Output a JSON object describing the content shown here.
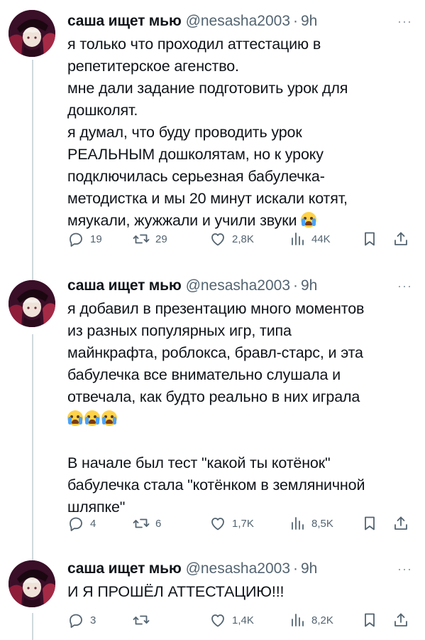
{
  "tweets": [
    {
      "name": "саша ищет мью",
      "handle": "@nesasha2003",
      "dot": "·",
      "time": "9h",
      "more": "···",
      "lines": [
        "я только что проходил аттестацию в",
        "репетитерское агенство.",
        "мне дали задание подготовить урок для",
        "дошколят.",
        "я думал, что буду проводить урок",
        "РЕАЛЬНЫМ дошколятам, но к уроку",
        "подключилась серьезная бабулечка-",
        "методистка и мы 20 минут искали котят,",
        "мяукали, жужжали и учили звуки"
      ],
      "emoji": "loudly-crying-face",
      "stats": {
        "replies": "19",
        "reposts": "29",
        "likes": "2,8K",
        "views": "44K"
      }
    },
    {
      "name": "саша ищет мью",
      "handle": "@nesasha2003",
      "dot": "·",
      "time": "9h",
      "more": "···",
      "lines": [
        "я добавил в презентацию много моментов",
        "из разных популярных игр, типа",
        "майнкрафта, роблокса, бравл-старс, и эта",
        "бабулечка все внимательно слушала и",
        "отвечала, как будто реально в них играла"
      ],
      "emoji_count": 3,
      "lines_2": [
        "В начале был тест \"какой ты котёнок\"",
        "бабулечка стала \"котёнком в земляничной",
        "шляпке\""
      ],
      "stats": {
        "replies": "4",
        "reposts": "6",
        "likes": "1,7K",
        "views": "8,5K"
      }
    },
    {
      "name": "саша ищет мью",
      "handle": "@nesasha2003",
      "dot": "·",
      "time": "9h",
      "more": "···",
      "lines": [
        "И Я ПРОШЁЛ АТТЕСТАЦИЮ!!!"
      ],
      "stats": {
        "replies": "3",
        "reposts": "",
        "likes": "1,4K",
        "views": "8,2K"
      }
    }
  ],
  "icons": {
    "reply": "reply-icon",
    "repost": "repost-icon",
    "like": "like-icon",
    "views": "views-icon",
    "bookmark": "bookmark-icon",
    "share": "share-icon"
  },
  "colors": {
    "text": "#0f1419",
    "secondary": "#536471",
    "thread_line": "#cfd9de"
  }
}
